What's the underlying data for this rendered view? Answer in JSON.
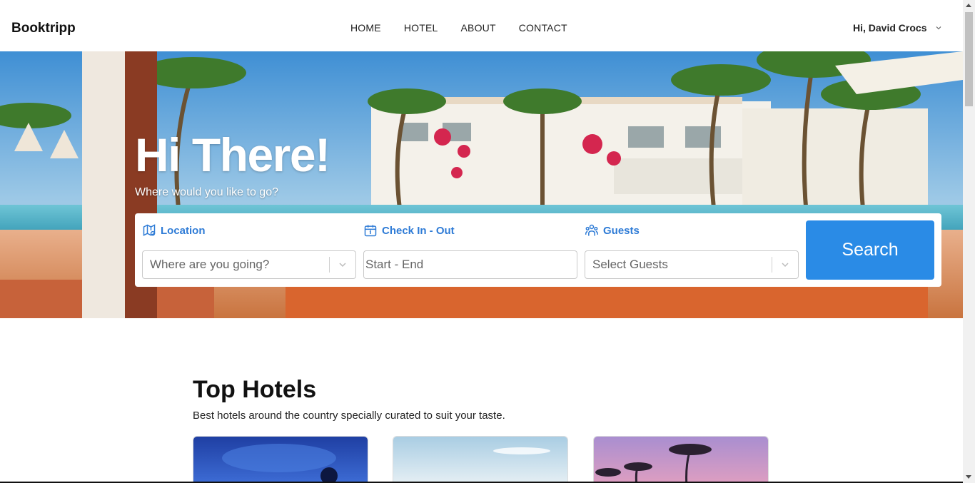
{
  "header": {
    "brand": "Booktripp",
    "nav": [
      "HOME",
      "HOTEL",
      "ABOUT",
      "CONTACT"
    ],
    "user_greeting": "Hi, David Crocs"
  },
  "hero": {
    "title": "Hi There!",
    "subtitle": "Where would you like to go?"
  },
  "search": {
    "location_label": "Location",
    "location_placeholder": "Where are you going?",
    "dates_label": "Check In - Out",
    "dates_placeholder": "Start - End",
    "guests_label": "Guests",
    "guests_placeholder": "Select Guests",
    "button": "Search"
  },
  "top_hotels": {
    "title": "Top Hotels",
    "subtitle": "Best hotels around the country specially curated to suit your taste."
  },
  "colors": {
    "accent": "#2a8be6",
    "label_blue": "#2e7bd6"
  },
  "icons": [
    "map-pin-icon",
    "calendar-icon",
    "users-icon",
    "chevron-down-icon"
  ]
}
